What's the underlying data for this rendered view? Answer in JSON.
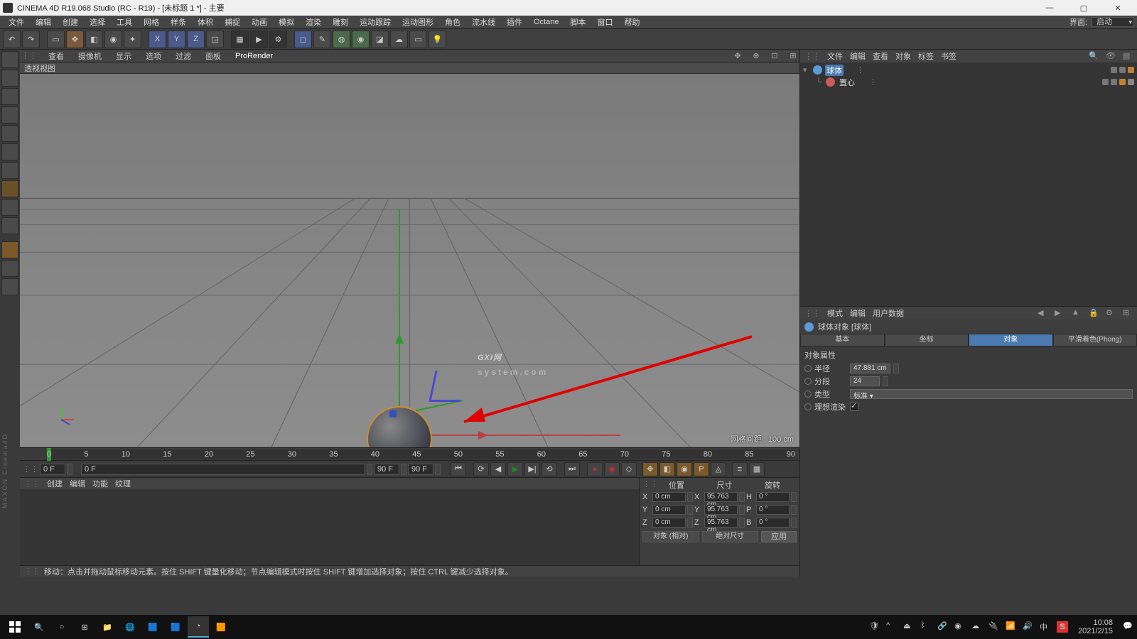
{
  "title": "CINEMA 4D R19.068 Studio (RC - R19) - [未标题 1 *] - 主要",
  "menus": [
    "文件",
    "编辑",
    "创建",
    "选择",
    "工具",
    "网格",
    "样条",
    "体积",
    "捕捉",
    "动画",
    "模拟",
    "渲染",
    "雕刻",
    "运动跟踪",
    "运动图形",
    "角色",
    "流水线",
    "插件",
    "Octane",
    "脚本",
    "窗口",
    "帮助"
  ],
  "layout_label": "界面:",
  "layout_value": "启动",
  "viewport_tabs": [
    "查看",
    "摄像机",
    "显示",
    "选项",
    "过滤",
    "面板",
    "ProRender"
  ],
  "viewport_title": "透视视图",
  "grid_info": "网格间距 : 100 cm",
  "timeline": {
    "start": 0,
    "end": 90,
    "ticks": [
      "0",
      "5",
      "10",
      "15",
      "20",
      "25",
      "30",
      "35",
      "40",
      "45",
      "50",
      "55",
      "60",
      "65",
      "70",
      "75",
      "80",
      "85",
      "90"
    ]
  },
  "frame_start": "0 F",
  "frame_cur": "0 F",
  "frame_end_a": "90 F",
  "frame_end_b": "90 F",
  "mat_tabs": [
    "创建",
    "编辑",
    "功能",
    "纹理"
  ],
  "coord": {
    "hdr": [
      "位置",
      "尺寸",
      "旋转"
    ],
    "rows": [
      {
        "a": "X",
        "p": "0 cm",
        "s": "95.763 cm",
        "rl": "H",
        "r": "0 °"
      },
      {
        "a": "Y",
        "p": "0 cm",
        "s": "95.763 cm",
        "rl": "P",
        "r": "0 °"
      },
      {
        "a": "Z",
        "p": "0 cm",
        "s": "95.763 cm",
        "rl": "B",
        "r": "0 °"
      }
    ],
    "sel1": "对象 (相对)",
    "sel2": "绝对尺寸",
    "btn": "应用"
  },
  "status": "移动：点击并拖动鼠标移动元素。按住 SHIFT 键量化移动；节点编辑模式时按住 SHIFT 键增加选择对象；按住 CTRL 键减少选择对象。",
  "obj_tabs": [
    "文件",
    "编辑",
    "查看",
    "对象",
    "标签",
    "书签"
  ],
  "objects": [
    {
      "icon": "#5a9bd5",
      "name": "球体",
      "selected": true,
      "tags": [
        "vis",
        "vis",
        "phong"
      ]
    },
    {
      "icon": "#d05a5a",
      "name": "置心",
      "selected": false,
      "tags": [
        "vis",
        "vis",
        "tgt",
        "chk"
      ],
      "indent": 1
    }
  ],
  "attr_tabs_hdr": [
    "模式",
    "编辑",
    "用户数据"
  ],
  "attr_title": "球体对象 [球体]",
  "attr_tabs": [
    "基本",
    "坐标",
    "对象",
    "平滑着色(Phong)"
  ],
  "attr_active": 2,
  "attr_section": "对象属性",
  "attr_rows": [
    {
      "label": "半径",
      "value": "47.881 cm",
      "spin": true
    },
    {
      "label": "分段",
      "value": "24",
      "spin": true
    },
    {
      "label": "类型",
      "value": "标准",
      "dropdown": true
    },
    {
      "label": "理想渲染",
      "check": true
    }
  ],
  "watermark": "GXI网",
  "watermark_sub": "system.com",
  "vmaxon": "MAXON Cinema4D",
  "clock_time": "10:08",
  "clock_date": "2021/2/15",
  "ime": "中"
}
